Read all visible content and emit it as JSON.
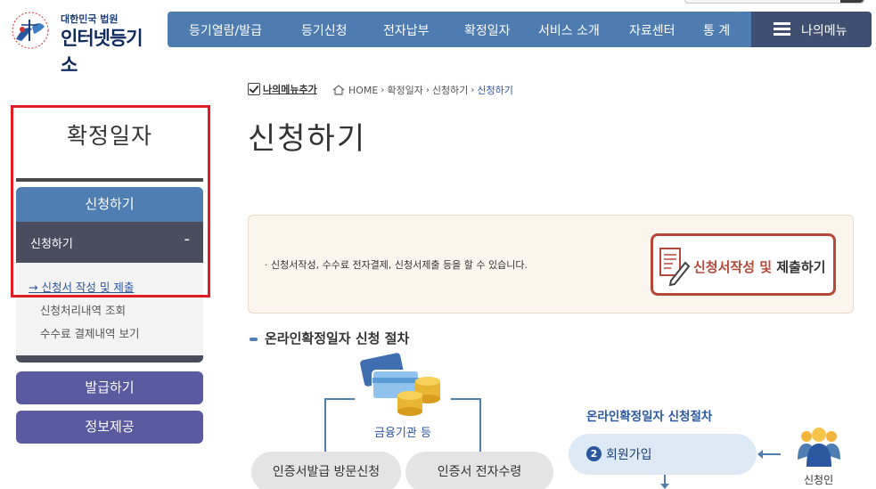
{
  "header": {
    "logo_sub": "대한민국 법원",
    "logo_main": "인터넷등기소",
    "nav": [
      "등기열람/발급",
      "등기신청",
      "전자납부",
      "확정일자",
      "서비스 소개",
      "자료센터",
      "통 계"
    ],
    "my_menu": "나의메뉴"
  },
  "sidebar": {
    "title": "확정일자",
    "current": "신청하기",
    "sub_title": "신청하기",
    "sub_toggle": "-",
    "items": [
      "→ 신청서 작성 및 제출",
      "신청처리내역 조회",
      "수수료 결제내역 보기"
    ],
    "buttons": [
      "발급하기",
      "정보제공"
    ]
  },
  "breadcrumb": {
    "add_menu": "나의메뉴추가",
    "home": "HOME",
    "level1": "확정일자",
    "level2": "신청하기",
    "current": "신청하기"
  },
  "main": {
    "page_title": "신청하기",
    "info_desc": "·  신청서작성, 수수료 전자결제, 신청서제출 등을 할 수 있습니다.",
    "apply_btn_red": "신청서작성 및",
    "apply_btn_dark": " 제출하기",
    "section_title": "온라인확정일자 신청 절차",
    "bank_label": "금융기관 등",
    "pill_visit": "인증서발급 방문신청",
    "pill_receive": "인증서 전자수령",
    "proc_title": "온라인확정일자 신청절차",
    "step_num": "2",
    "step_label": "회원가입",
    "applicant": "신청인"
  },
  "colors": {
    "nav_blue": "#4e7bb0",
    "my_menu_navy": "#3f4f71",
    "sidebar_purple": "#5a5aa0",
    "highlight_red": "#e01d24",
    "apply_border": "#b4493a"
  }
}
